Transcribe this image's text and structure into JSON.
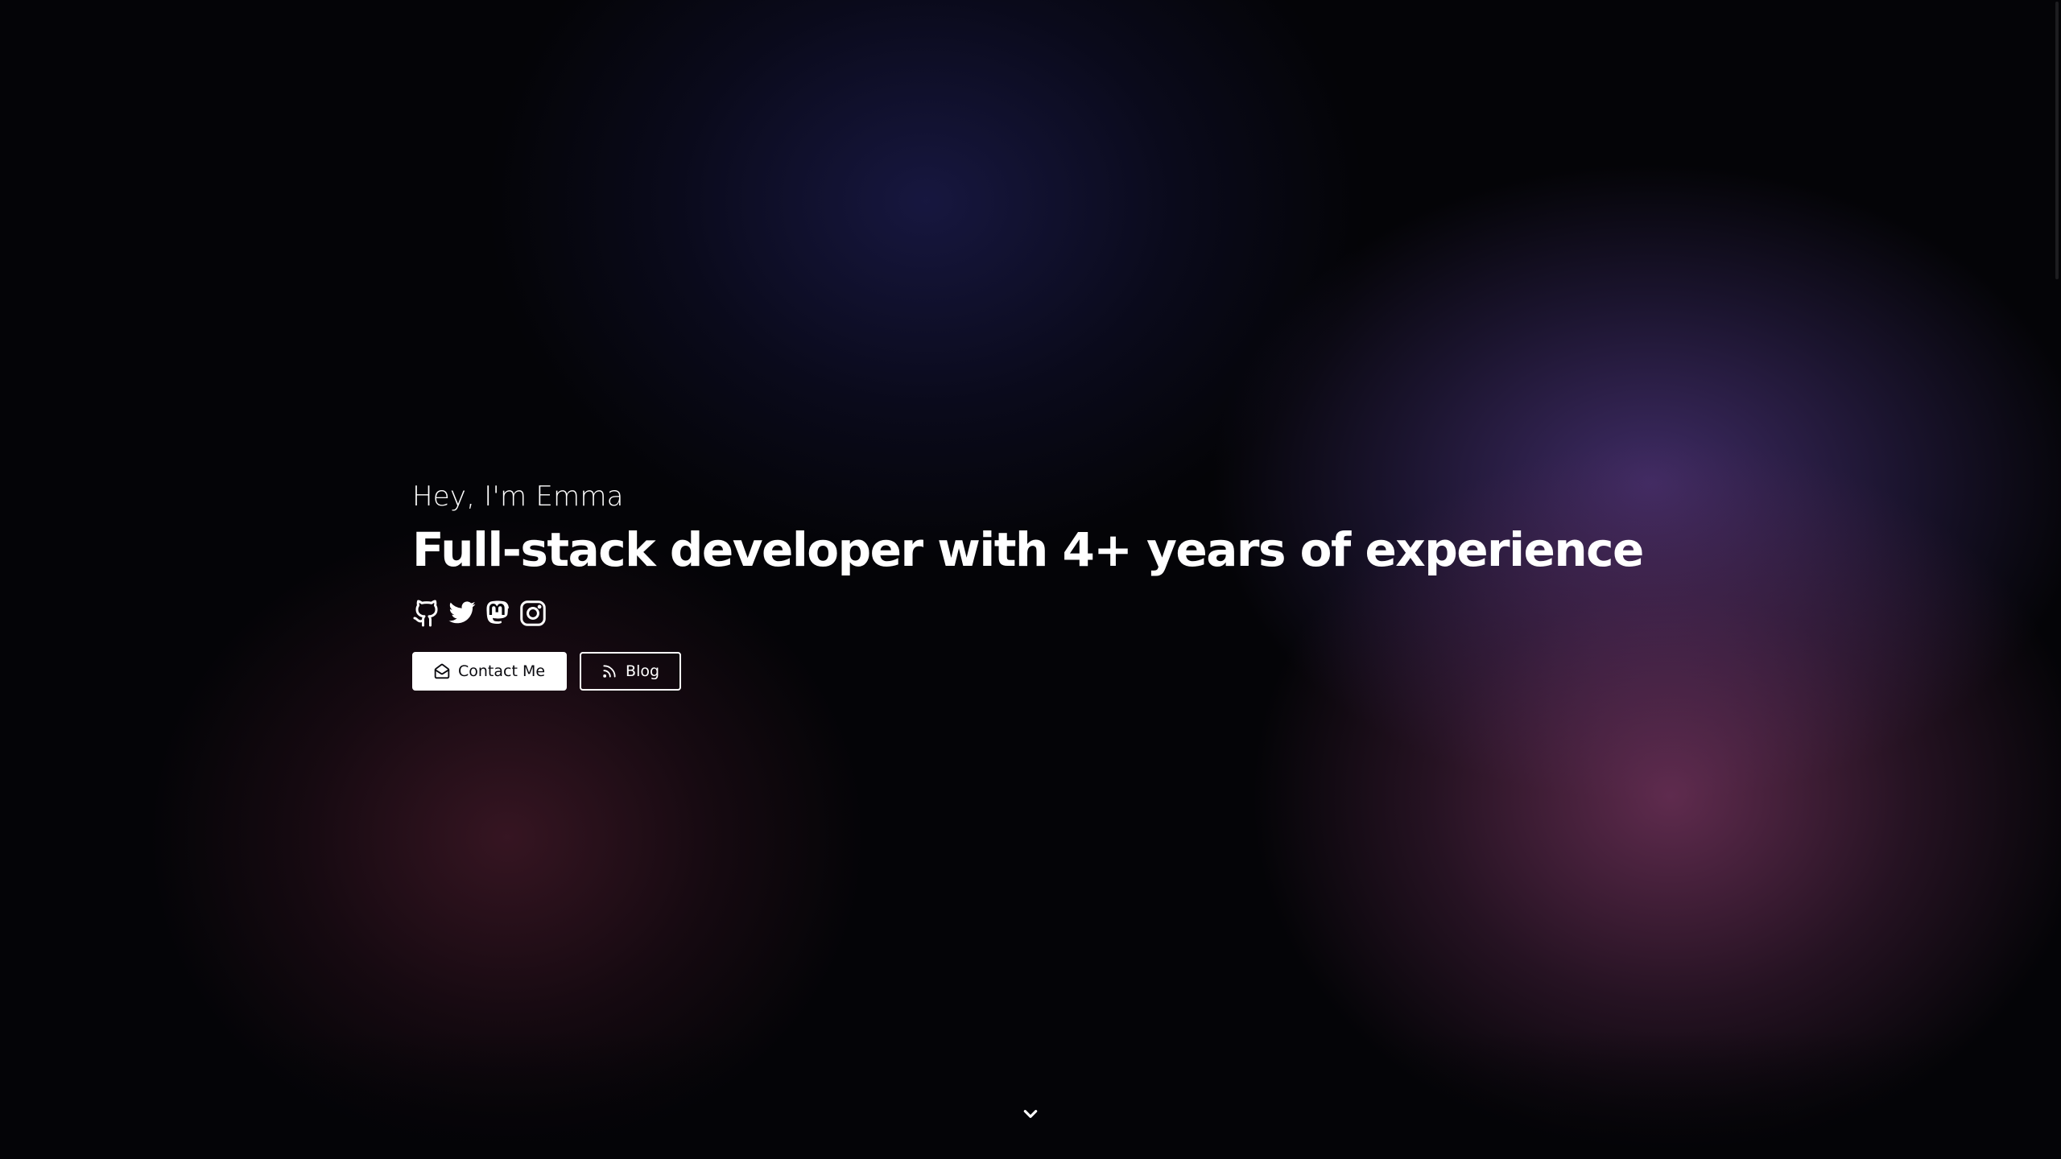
{
  "hero": {
    "greeting": "Hey, I'm Emma",
    "headline": "Full-stack developer with 4+ years of experience"
  },
  "socials": [
    {
      "name": "github",
      "icon": "github-icon"
    },
    {
      "name": "twitter",
      "icon": "twitter-icon"
    },
    {
      "name": "mastodon",
      "icon": "mastodon-icon"
    },
    {
      "name": "instagram",
      "icon": "instagram-icon"
    }
  ],
  "actions": {
    "contact_label": "Contact Me",
    "contact_icon": "mail-open-icon",
    "blog_label": "Blog",
    "blog_icon": "rss-icon"
  },
  "scroll_indicator": {
    "icon": "chevron-down-icon"
  },
  "colors": {
    "background": "#040407",
    "text": "#ffffff",
    "glow_navy": "#1e1e55",
    "glow_violet": "#583c8c",
    "glow_magenta": "#823a69",
    "glow_maroon": "#4b1c2d"
  }
}
